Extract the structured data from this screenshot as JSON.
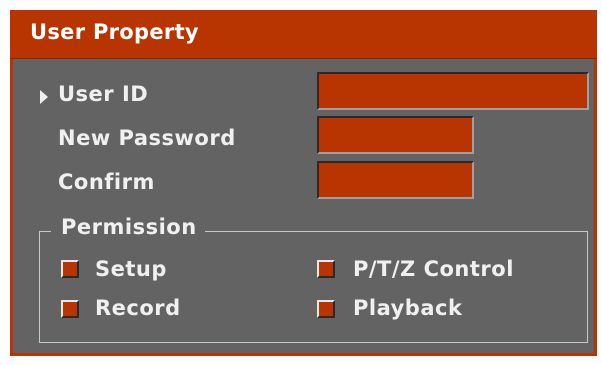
{
  "dialog": {
    "title": "User Property"
  },
  "fields": {
    "user_id": {
      "label": "User ID",
      "value": ""
    },
    "new_password": {
      "label": "New Password",
      "value": ""
    },
    "confirm": {
      "label": "Confirm",
      "value": ""
    }
  },
  "permission": {
    "title": "Permission",
    "items": [
      {
        "label": "Setup",
        "checked": false
      },
      {
        "label": "P/T/Z Control",
        "checked": false
      },
      {
        "label": "Record",
        "checked": false
      },
      {
        "label": "Playback",
        "checked": false
      }
    ]
  },
  "colors": {
    "accent": "#b83400",
    "panel": "#636363",
    "text": "#f0f0f0"
  },
  "icons": {
    "selected_row": "triangle-right-icon"
  }
}
